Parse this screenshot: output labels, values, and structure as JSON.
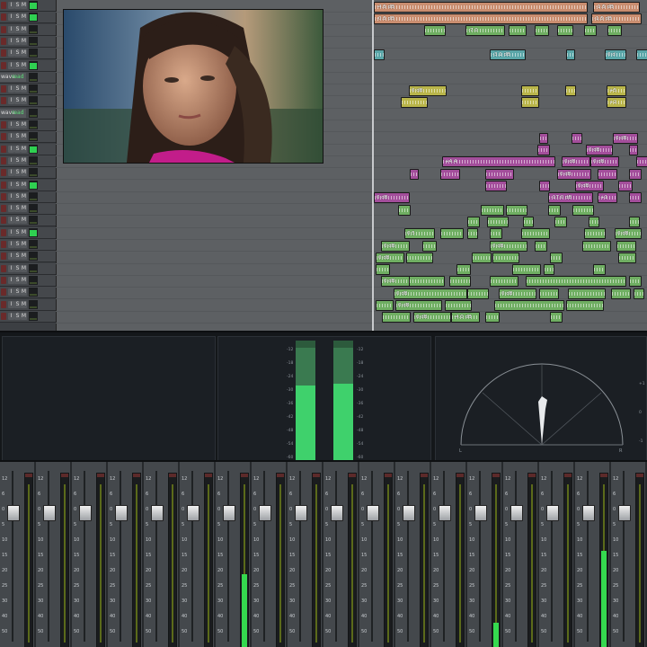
{
  "track_header": {
    "rec_label": "",
    "input_label": "I",
    "solo_label": "S",
    "mute_label": "M",
    "wave_label": "wave",
    "read_label": "read"
  },
  "clip_labels": {
    "t1a": "-4.5 dB",
    "t1b": "-1.5 dB",
    "t2a": "-0.5 dB",
    "t2b": "-1.5 dB",
    "t3a": "-7.0",
    "t4a": "-3.1 dB",
    "t4b": "0 d",
    "t5a": "0 dB",
    "t5b": "+5.",
    "t6a": "+2.",
    "t7a": "0 dB",
    "t8a": "0 dB",
    "t9a": "+4.4",
    "t9b": "0 dB",
    "t9c": "0 dB",
    "t10a": "0 dB",
    "t11a": "0 dB",
    "t12a": "0 dB",
    "t12b": "-17.0 dB",
    "t12c": "+1",
    "t15a": "0.5",
    "t15b": "0 dB",
    "t16a": "0 dB",
    "t16b": "0 dB",
    "t17a": "0 dB",
    "t18a": "0 dB",
    "t19a": "0 dB",
    "t19b": "0 dB",
    "t20a": "0 dB",
    "t21a": "0 dB",
    "t22a": "-4.0 dB"
  },
  "mid_scale": [
    "-12",
    "-18",
    "-24",
    "-30",
    "-36",
    "-42",
    "-48",
    "-54",
    "-60"
  ],
  "mid_meter_levels": [
    0.63,
    0.65
  ],
  "right_scale": [
    "+1",
    "0",
    "-1"
  ],
  "mixer_scale": [
    "12",
    "6",
    "0",
    "5",
    "10",
    "15",
    "20",
    "25",
    "30",
    "40",
    "50"
  ],
  "mixer_levels": [
    0,
    0,
    0,
    0,
    0,
    0,
    0.42,
    0,
    0,
    0,
    0,
    0,
    0,
    0.14,
    0,
    0,
    0.55
  ],
  "colors": {
    "audio_green": "#6fae62",
    "audio_yellow": "#b9b54a",
    "audio_pink": "#a34e9b",
    "audio_orange": "#c98d6f",
    "audio_teal": "#5aa6a8",
    "meter_green": "#35d94f"
  },
  "icons": [
    "record-icon",
    "input-monitor-icon",
    "solo-icon",
    "mute-icon",
    "playhead-icon",
    "pan-display-icon"
  ]
}
